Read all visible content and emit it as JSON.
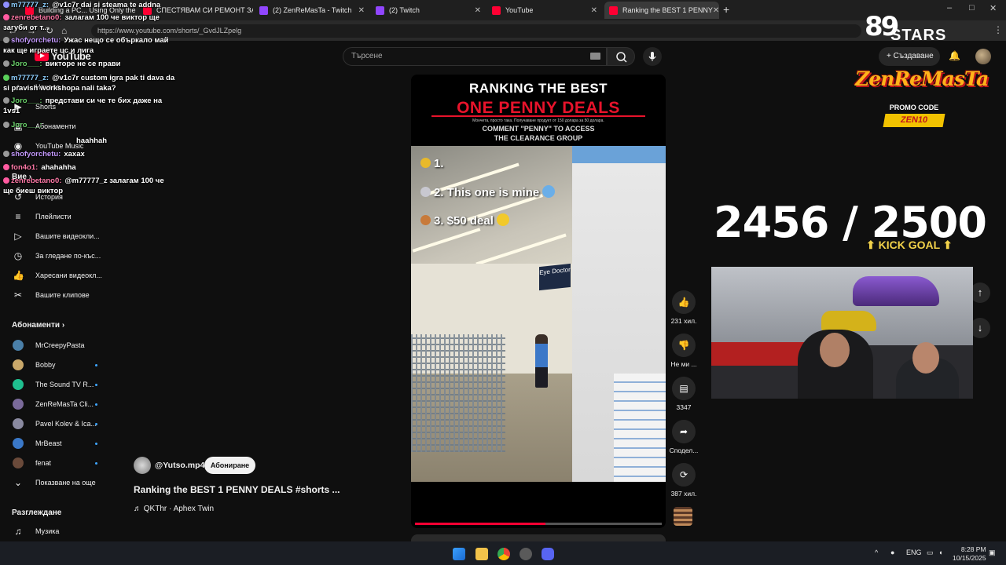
{
  "browser": {
    "tabs": [
      {
        "label": "Building a PC... Using Only the",
        "icon": "youtube"
      },
      {
        "label": "СПЕСТЯВАМ СИ РЕМОНТ ЗА 3",
        "icon": "youtube"
      },
      {
        "label": "(2) ZenReMasTa - Twitch",
        "icon": "twitch"
      },
      {
        "label": "(2) Twitch",
        "icon": "twitch"
      },
      {
        "label": "YouTube",
        "icon": "youtube"
      },
      {
        "label": "Ranking the BEST 1 PENNY",
        "icon": "youtube",
        "active": true
      }
    ],
    "url": "https://www.youtube.com/shorts/_GvdJLZpelg"
  },
  "youtube": {
    "logo": "YouTube",
    "search_placeholder": "Търсене",
    "create_label": "Създаване",
    "sidebar": {
      "top_items": [
        {
          "label": "Начало",
          "icon": "home-icon"
        },
        {
          "label": "Shorts",
          "icon": "shorts-icon"
        },
        {
          "label": "Абонаменти",
          "icon": "subscriptions-icon"
        },
        {
          "label": "YouTube Music",
          "icon": "music-icon"
        }
      ],
      "you_heading": "Вие",
      "you_items": [
        {
          "label": "История",
          "icon": "history-icon"
        },
        {
          "label": "Плейлисти",
          "icon": "playlist-icon"
        },
        {
          "label": "Вашите видеокли...",
          "icon": "video-icon"
        },
        {
          "label": "За гледане по-къс...",
          "icon": "clock-icon"
        },
        {
          "label": "Харесани видеокл...",
          "icon": "like-icon"
        },
        {
          "label": "Вашите клипове",
          "icon": "scissors-icon"
        }
      ],
      "subs_heading": "Абонаменти",
      "subscriptions": [
        {
          "name": "MrCreepyPasta",
          "color": "#4a7fa8"
        },
        {
          "name": "Bobby",
          "color": "#c9a86a"
        },
        {
          "name": "The Sound TV R...",
          "color": "#1fbf8f"
        },
        {
          "name": "ZenReMasTa Cli...",
          "color": "#7a6a9a"
        },
        {
          "name": "Pavel Kolev & Ica...",
          "color": "#8a8aa0"
        },
        {
          "name": "MrBeast",
          "color": "#3a78c8"
        },
        {
          "name": "fenat",
          "color": "#6a4a3a"
        }
      ],
      "show_more": "Показване на още",
      "explore_heading": "Разглеждане",
      "explore_items": [
        {
          "label": "Музика",
          "icon": "music-note-icon"
        }
      ]
    },
    "video": {
      "title_line1": "RANKING THE BEST",
      "title_line2": "ONE PENNY DEALS",
      "sub_caption": "Мончета, просто така. Получаване продукт от 150 долара за 50 долара.",
      "comment_line1": "COMMENT \"PENNY\" TO ACCESS",
      "comment_line2": "THE CLEARANCE GROUP",
      "rank1": "1.",
      "rank2": "2. This one is mine",
      "rank3": "3. $50 deal",
      "sign_text": "Eye Doctor",
      "progress": 0.53
    },
    "actions": {
      "likes": "231 хил.",
      "dislike": "Не ми ...",
      "comments": "3347",
      "share": "Сподел...",
      "remix": "387 хил."
    },
    "channel": {
      "handle": "@Yutso.mp4",
      "subscribe_label": "Абониране",
      "video_title": "Ranking the BEST 1 PENNY DEALS #shorts ...",
      "music": "QKThr · Aphex Twin"
    }
  },
  "chat": [
    {
      "user": "m77777_z:",
      "msg": "@v1c7r dai si steama te addna",
      "color": "#8fd0ff"
    },
    {
      "user": "zenrebetano0:",
      "msg": "залагам 100 че виктор ще",
      "color": "#ff7aa8"
    },
    {
      "user": "",
      "msg": "загуби от т...",
      "color": "#ffffff"
    },
    {
      "user": "shofyorchetu:",
      "msg": "Ужас нещо се объркало май",
      "color": "#c59aff"
    },
    {
      "user": "",
      "msg": "как ще играете цс и лига",
      "color": "#ffffff"
    },
    {
      "user": "Joro___:",
      "msg": "викторе не се прави",
      "color": "#6ad06a"
    },
    {
      "user": "m77777_z:",
      "msg": "@v1c7r custom igra pak ti dava da",
      "color": "#8fd0ff"
    },
    {
      "user": "",
      "msg": "si pravish workshopa nali taka?",
      "color": "#ffffff"
    },
    {
      "user": "Joro___:",
      "msg": "представи си че те биx даже на",
      "color": "#6ad06a"
    },
    {
      "user": "",
      "msg": "1vs1",
      "color": "#ffffff"
    },
    {
      "user": "Joro___:",
      "msg": "",
      "color": "#6ad06a"
    },
    {
      "user": "",
      "msg": "haahhah",
      "color": "#ffffff"
    },
    {
      "user": "shofyorchetu:",
      "msg": "xaxax",
      "color": "#c59aff"
    },
    {
      "user": "fon4o1:",
      "msg": "ahahahha",
      "color": "#ff7aa8"
    },
    {
      "user": "zenrebetano0:",
      "msg": "@m77777_z залагам 100 че",
      "color": "#ff7aa8"
    },
    {
      "user": "",
      "msg": "ще биеш виктор",
      "color": "#ffffff"
    }
  ],
  "overlay": {
    "stars_number": "89",
    "stars_text": "STARS",
    "brand": "ZenReMasTa",
    "promo_label": "PROMO CODE",
    "promo_code": "ZEN10",
    "goal_count": "2456 / 2500",
    "goal_label": "KICK GOAL"
  },
  "taskbar": {
    "lang": "ENG",
    "time": "8:28 PM",
    "date": "10/15/2025"
  }
}
